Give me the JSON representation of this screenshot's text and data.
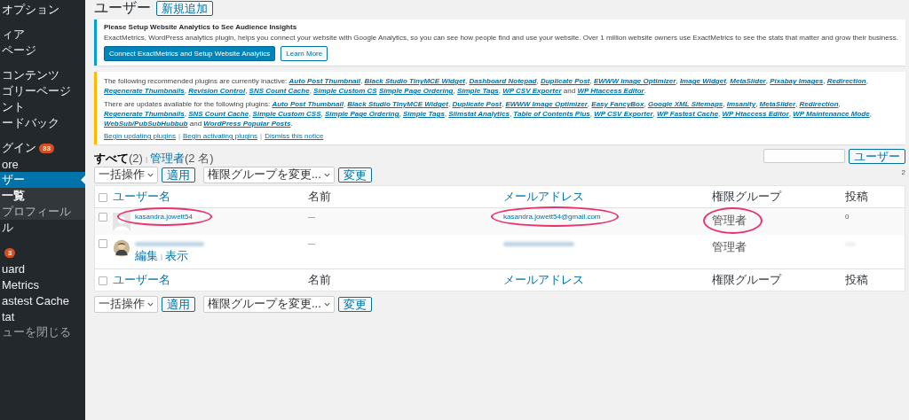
{
  "sidebar": {
    "groups": [
      [
        {
          "label": "オプション",
          "kind": "item",
          "selected": false
        }
      ],
      [
        {
          "label": "ィア",
          "kind": "item",
          "selected": false
        },
        {
          "label": "ページ",
          "kind": "item",
          "selected": false
        }
      ],
      [
        {
          "label": "コンテンツ",
          "kind": "item",
          "selected": false
        },
        {
          "label": "ゴリーページ",
          "kind": "item",
          "selected": false
        },
        {
          "label": "ント",
          "kind": "item",
          "selected": false
        },
        {
          "label": "ードバック",
          "kind": "item",
          "selected": false
        }
      ],
      [
        {
          "label": "グイン",
          "badge": "33",
          "kind": "item",
          "selected": false
        },
        {
          "label": "ore",
          "kind": "item",
          "selected": false
        },
        {
          "label": "ザー",
          "kind": "item",
          "selected": true
        },
        {
          "label": "一覧",
          "kind": "sub",
          "selected": true
        },
        {
          "label": "プロフィール",
          "kind": "sub",
          "selected": false
        },
        {
          "label": "ル",
          "kind": "item",
          "selected": false
        }
      ],
      [
        {
          "badge": "3",
          "kind": "item",
          "selected": false
        },
        {
          "label": "uard",
          "kind": "item",
          "selected": false
        },
        {
          "label": "Metrics",
          "kind": "item",
          "selected": false
        },
        {
          "label": "astest Cache",
          "kind": "item",
          "selected": false
        },
        {
          "label": "tat",
          "kind": "item",
          "selected": false
        },
        {
          "label": "ューを閉じる",
          "kind": "collapse",
          "selected": false
        }
      ]
    ]
  },
  "page": {
    "title": "ユーザー",
    "add_new": "新規追加"
  },
  "analytics_notice": {
    "title": "Please Setup Website Analytics to See Audience Insights",
    "body": "ExactMetrics, WordPress analytics plugin, helps you connect your website with Google Analytics, so you can see how people find and use your website. Over 1 million website owners use ExactMetrics to see the stats that matter and grow their business.",
    "primary_button": "Connect ExactMetrics and Setup Website Analytics",
    "secondary_button": "Learn More"
  },
  "plugins_notice": {
    "paragraphs": [
      {
        "intro": "The following recommended plugins are currently inactive: ",
        "plugins": [
          {
            "name": "Auto Post Thumbnail",
            "after": ", "
          },
          {
            "name": "Black Studio TinyMCE Widget",
            "after": ", "
          },
          {
            "name": "Dashboard Notepad",
            "after": ", "
          },
          {
            "name": "Duplicate Post",
            "after": ", "
          },
          {
            "name": "EWWW Image Optimizer",
            "after": ", "
          },
          {
            "name": "Image Widget",
            "after": ", "
          },
          {
            "name": "MetaSlider",
            "after": ", "
          },
          {
            "name": "Pixabay Images",
            "after": ", "
          },
          {
            "name": "Redirection",
            "after": ", "
          },
          {
            "name": "Regenerate Thumbnails",
            "after": ", "
          },
          {
            "name": "Revision Control",
            "after": ", "
          },
          {
            "name": "SNS Count Cache",
            "after": ", "
          },
          {
            "name": "Simple Custom CS"
          },
          {
            "name": "Simple Page Ordering",
            "after": ", "
          },
          {
            "name": "Simple Tags",
            "after": ", "
          },
          {
            "name": "WP CSV Exporter",
            "after": " and "
          },
          {
            "name": "WP Htaccess Editor",
            "after": "."
          }
        ]
      },
      {
        "intro": "There are updates available for the following plugins: ",
        "plugins": [
          {
            "name": "Auto Post Thumbnail",
            "after": ", "
          },
          {
            "name": "Black Studio TinyMCE Widget",
            "after": ", "
          },
          {
            "name": "Duplicate Post",
            "after": ", "
          },
          {
            "name": "EWWW Image Optimizer",
            "after": ", "
          },
          {
            "name": "Easy FancyBox",
            "after": ", "
          },
          {
            "name": "Google XML Sitemaps",
            "after": ", "
          },
          {
            "name": "Imsanity",
            "after": ", "
          },
          {
            "name": "MetaSlider",
            "after": ", "
          },
          {
            "name": "Redirection",
            "after": ", "
          },
          {
            "name": "Regenerate Thumbnails",
            "after": ", "
          },
          {
            "name": "SNS Count Cache",
            "after": ", "
          },
          {
            "name": "Simple Custom CSS",
            "after": ", "
          },
          {
            "name": "Simple Page Ordering",
            "after": ", "
          },
          {
            "name": "Simple Tags",
            "after": ", "
          },
          {
            "name": "Slimstat Analytics",
            "after": ", "
          },
          {
            "name": "Table of Contents Plus",
            "after": ", "
          },
          {
            "name": "WP CSV Exporter",
            "after": ", "
          },
          {
            "name": "WP Fastest Cache",
            "after": ", "
          },
          {
            "name": "WP Htaccess Editor",
            "after": ", "
          },
          {
            "name": "WP Maintenance Mode",
            "after": ", "
          },
          {
            "name": "WebSub/PubSubHubbub",
            "after": " and "
          },
          {
            "name": "WordPress Popular Posts",
            "after": "."
          }
        ]
      }
    ],
    "actions": [
      "Begin updating plugins",
      "Begin activating plugins",
      "Dismiss this notice"
    ],
    "separator": "|"
  },
  "views": [
    {
      "label": "すべて",
      "count": "(2)",
      "selected": true
    },
    {
      "label": "管理者",
      "count": "(2 名)",
      "selected": false
    }
  ],
  "views_separator": "|",
  "search": {
    "button": "ユーザー"
  },
  "items_count": "2",
  "toolbars": [
    {
      "bulk_select": "一括操作",
      "apply": "適用",
      "role_select": "権限グループを変更...",
      "change": "変更"
    },
    {
      "bulk_select": "一括操作",
      "apply": "適用",
      "role_select": "権限グループを変更...",
      "change": "変更"
    }
  ],
  "table": {
    "header_checked": false,
    "footer_checked": false,
    "columns": [
      {
        "label": "ユーザー名",
        "sortable": true
      },
      {
        "label": "名前",
        "sortable": false
      },
      {
        "label": "メールアドレス",
        "sortable": true
      },
      {
        "label": "権限グループ",
        "sortable": false
      },
      {
        "label": "投稿",
        "sortable": false
      }
    ],
    "footer_columns": [
      {
        "label": "ユーザー名",
        "sortable": true
      },
      {
        "label": "名前",
        "sortable": false
      },
      {
        "label": "メールアドレス",
        "sortable": true
      },
      {
        "label": "権限グループ",
        "sortable": false
      },
      {
        "label": "投稿",
        "sortable": false
      }
    ],
    "rows": [
      {
        "username": "kasandra.jowett54",
        "name": "—",
        "email": "kasandra.jowett54@gmail.com",
        "role": "管理者",
        "posts": "0",
        "kind": "default",
        "blurred": false,
        "circled": true,
        "checked": false
      },
      {
        "name": "—",
        "role": "管理者",
        "kind": "photo",
        "blurred": true,
        "circled": false,
        "checked": false,
        "actions": [
          "編集",
          "表示"
        ],
        "actions_separator": "|"
      }
    ]
  }
}
